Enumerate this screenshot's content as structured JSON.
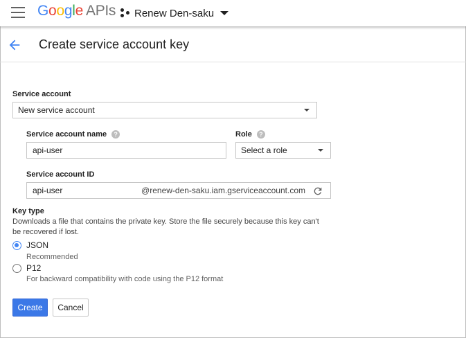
{
  "topbar": {
    "logo_letters": [
      "G",
      "o",
      "o",
      "g",
      "l",
      "e"
    ],
    "logo_suffix": "APIs",
    "project_name": "Renew Den-saku"
  },
  "header": {
    "title": "Create service account key"
  },
  "form": {
    "service_account": {
      "label": "Service account",
      "value": "New service account"
    },
    "service_account_name": {
      "label": "Service account name",
      "value": "api-user"
    },
    "role": {
      "label": "Role",
      "value": "Select a role"
    },
    "service_account_id": {
      "label": "Service account ID",
      "value": "api-user",
      "suffix": "@renew-den-saku.iam.gserviceaccount.com"
    },
    "key_type": {
      "label": "Key type",
      "description_line1": "Downloads a file that contains the private key. Store the file securely because this key can't",
      "description_line2": "be recovered if lost.",
      "options": [
        {
          "label": "JSON",
          "sub": "Recommended",
          "selected": true
        },
        {
          "label": "P12",
          "sub": "For backward compatibility with code using the P12 format",
          "selected": false
        }
      ]
    }
  },
  "actions": {
    "create_label": "Create",
    "cancel_label": "Cancel"
  },
  "colors": {
    "accent": "#4285f4",
    "primary_button": "#3b78e7"
  }
}
